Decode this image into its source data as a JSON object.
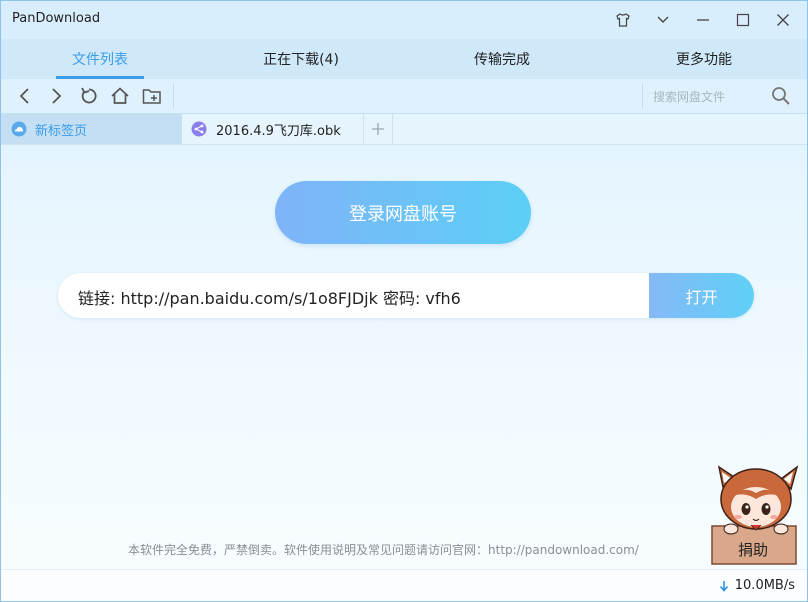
{
  "window": {
    "title": "PanDownload"
  },
  "titlebar_icons": [
    "shirt-icon",
    "chevron-down-icon",
    "minimize-icon",
    "maximize-icon",
    "close-icon"
  ],
  "nav": {
    "tabs": [
      {
        "label": "文件列表",
        "active": true
      },
      {
        "label": "正在下载(4)",
        "active": false
      },
      {
        "label": "传输完成",
        "active": false
      },
      {
        "label": "更多功能",
        "active": false
      }
    ]
  },
  "toolbar": {
    "icons": [
      "back-arrow-icon",
      "forward-arrow-icon",
      "refresh-icon",
      "home-icon",
      "new-folder-icon"
    ],
    "search_placeholder": "搜索网盘文件"
  },
  "page_tabs": [
    {
      "label": "新标签页",
      "icon": "cloud-icon",
      "active": true
    },
    {
      "label": "2016.4.9飞刀库.obk",
      "icon": "share-icon",
      "active": false
    }
  ],
  "main": {
    "login_label": "登录网盘账号",
    "link_value": "链接: http://pan.baidu.com/s/1o8FJDjk 密码: vfh6",
    "open_label": "打开"
  },
  "footer": {
    "notice": "本软件完全免费，严禁倒卖。软件使用说明及常见问题请访问官网：http://pandownload.com/",
    "speed": "10.0MB/s",
    "donate_label": "捐助"
  },
  "colors": {
    "accent": "#3b9ce8",
    "button_start": "#7fb4f8",
    "button_end": "#5ccff6"
  }
}
